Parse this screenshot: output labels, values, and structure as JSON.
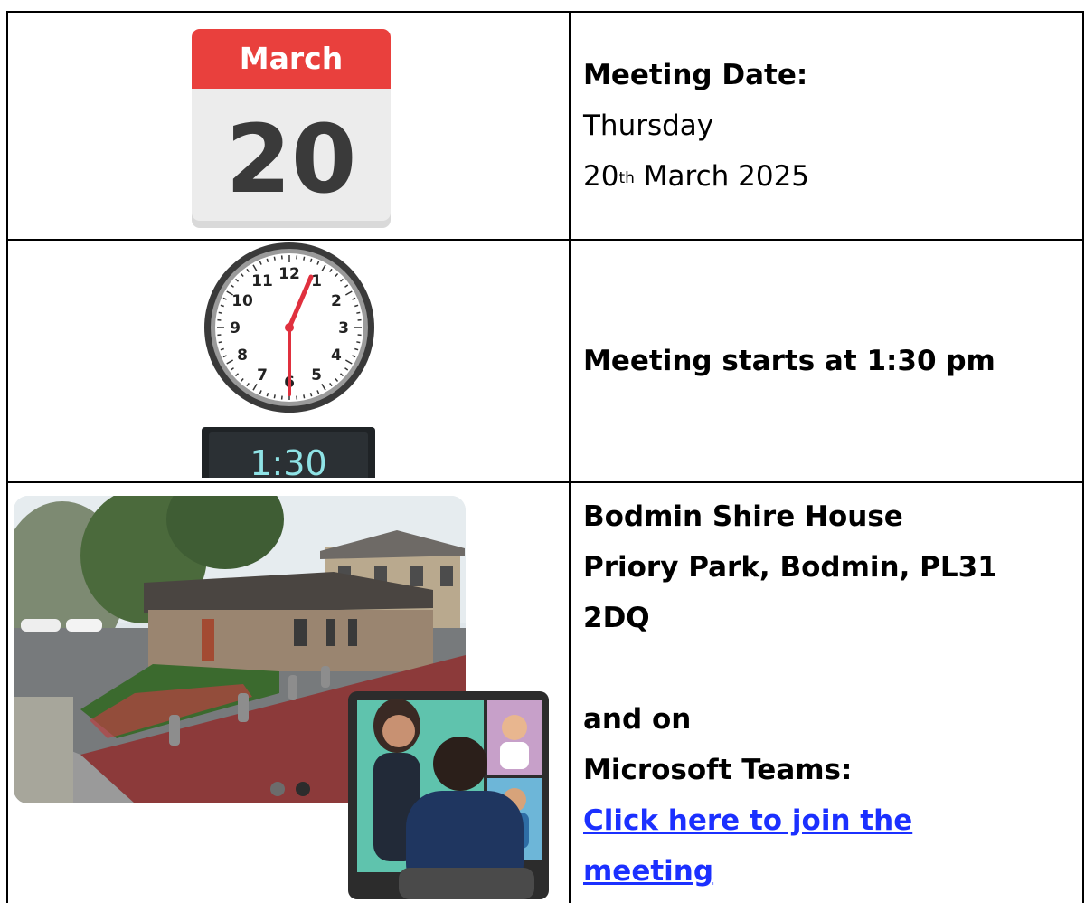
{
  "calendar": {
    "month": "March",
    "day": "20"
  },
  "clock": {
    "digital_time": "1:30",
    "dial_numbers": [
      "12",
      "1",
      "2",
      "3",
      "4",
      "5",
      "6",
      "7",
      "8",
      "9",
      "10",
      "11"
    ]
  },
  "date_block": {
    "label": "Meeting Date:",
    "weekday": "Thursday",
    "day_number": "20",
    "ordinal_suffix": "th",
    "month_year": "March 2025"
  },
  "time_block": {
    "text": "Meeting starts at 1:30 pm"
  },
  "location_block": {
    "line1": "Bodmin Shire House",
    "line2": "Priory Park, Bodmin, PL31",
    "line3": "2DQ",
    "and_on": "and on",
    "teams": "Microsoft Teams:",
    "link_line1": "Click here to join the",
    "link_line2": "meeting"
  },
  "colors": {
    "calendar_red": "#e9403d",
    "link_blue": "#1b30ff"
  }
}
